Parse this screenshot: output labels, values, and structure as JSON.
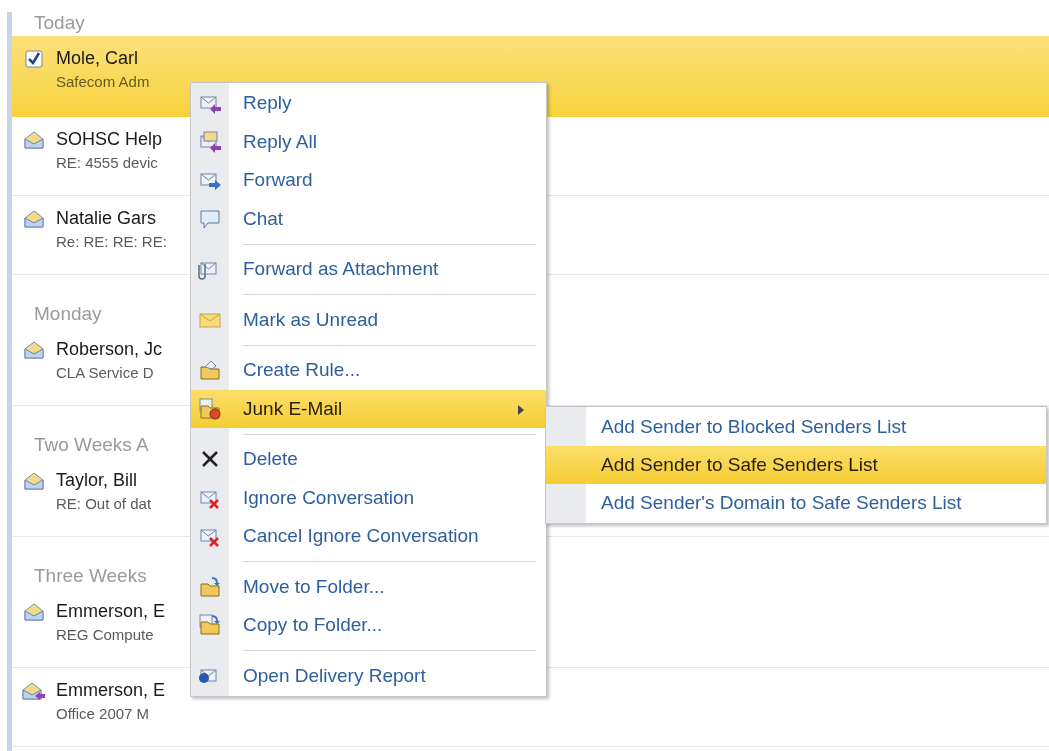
{
  "message_list": {
    "groups": [
      {
        "header": "Today",
        "messages": [
          {
            "kind": "checkbox",
            "checked": true,
            "sender": "Mole, Carl",
            "preview": "Safecom Adm",
            "selected": true
          },
          {
            "kind": "open-envelope",
            "sender": "SOHSC Help",
            "preview": "RE: 4555 devic",
            "selected": false
          },
          {
            "kind": "open-envelope",
            "sender": "Natalie Gars",
            "preview": "Re: RE: RE: RE:",
            "selected": false
          }
        ]
      },
      {
        "header": "Monday",
        "messages": [
          {
            "kind": "open-envelope",
            "sender": "Roberson, Jc",
            "preview": "CLA Service D",
            "selected": false
          }
        ]
      },
      {
        "header": "Two Weeks A",
        "messages": [
          {
            "kind": "open-envelope",
            "sender": "Taylor, Bill",
            "preview": "RE: Out of dat",
            "selected": false
          }
        ]
      },
      {
        "header": "Three Weeks",
        "messages": [
          {
            "kind": "open-envelope",
            "sender": "Emmerson, E",
            "preview": "REG Compute",
            "selected": false
          },
          {
            "kind": "replied-envelope",
            "sender": "Emmerson, E",
            "preview": "Office 2007 M",
            "selected": false
          }
        ]
      }
    ]
  },
  "context_menu": {
    "items": [
      {
        "kind": "reply",
        "label": "Reply",
        "selected": false
      },
      {
        "kind": "reply-all",
        "label": "Reply All",
        "selected": false
      },
      {
        "kind": "forward",
        "label": "Forward",
        "selected": false
      },
      {
        "kind": "chat",
        "label": "Chat",
        "selected": false
      },
      {
        "kind": "separator"
      },
      {
        "kind": "attachment",
        "label": "Forward as Attachment",
        "selected": false
      },
      {
        "kind": "separator"
      },
      {
        "kind": "unread",
        "label": "Mark as Unread",
        "selected": false
      },
      {
        "kind": "separator"
      },
      {
        "kind": "rule",
        "label": "Create Rule...",
        "selected": false
      },
      {
        "kind": "junk",
        "label": "Junk E-Mail",
        "selected": true,
        "has_submenu": true
      },
      {
        "kind": "separator"
      },
      {
        "kind": "delete",
        "label": "Delete",
        "selected": false
      },
      {
        "kind": "ignore",
        "label": "Ignore Conversation",
        "selected": false
      },
      {
        "kind": "ignore",
        "label": "Cancel Ignore Conversation",
        "selected": false
      },
      {
        "kind": "separator"
      },
      {
        "kind": "move",
        "label": "Move to Folder...",
        "selected": false
      },
      {
        "kind": "copy",
        "label": "Copy to Folder...",
        "selected": false
      },
      {
        "kind": "separator"
      },
      {
        "kind": "report",
        "label": "Open Delivery Report",
        "selected": false
      }
    ]
  },
  "submenu": {
    "items": [
      {
        "label": "Add Sender to Blocked Senders List",
        "selected": false
      },
      {
        "label": "Add Sender to Safe Senders List",
        "selected": true
      },
      {
        "label": "Add Sender's Domain to Safe Senders List",
        "selected": false
      }
    ]
  }
}
